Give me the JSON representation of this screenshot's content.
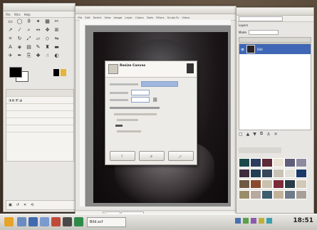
{
  "toolbox": {
    "menu": [
      "File",
      "Xtns",
      "Help"
    ],
    "brush_label": "Scaled...",
    "options_rows": [
      "",
      "",
      "",
      ""
    ]
  },
  "image_window": {
    "menu": [
      "File",
      "Edit",
      "Select",
      "View",
      "Image",
      "Layer",
      "Colors",
      "Tools",
      "Filters",
      "Script-Fu",
      "Video",
      "Windows",
      "Help"
    ],
    "status": "px"
  },
  "dialog": {
    "title": "Resize Canvas",
    "subtitle": "",
    "ok_label": "",
    "cancel_label": "",
    "reset_label": "",
    "help_label": ""
  },
  "layers": {
    "tab_label": "Layers",
    "mode_label": "Mode",
    "layer_name": "Bild"
  },
  "taskbar": {
    "clock": "18:51",
    "task_label": "Bild.xcf"
  },
  "palette_colors": [
    "#1c4a4a",
    "#2c3c5e",
    "#5d2a38",
    "#e8e1d4",
    "#5e5d7a",
    "#8e8a9f",
    "#3d2c3b",
    "#1f3e53",
    "#36475c",
    "#c7c2b3",
    "#e2dfd9",
    "#1a3b6a",
    "#6e5942",
    "#8a4a2d",
    "#c9c1ad",
    "#7c2b38",
    "#2a3b49",
    "#d1c8b6",
    "#9b8c69",
    "#b7a8a0",
    "#3c5d6e",
    "#c3b29a",
    "#6f7b88",
    "#a6a099"
  ]
}
